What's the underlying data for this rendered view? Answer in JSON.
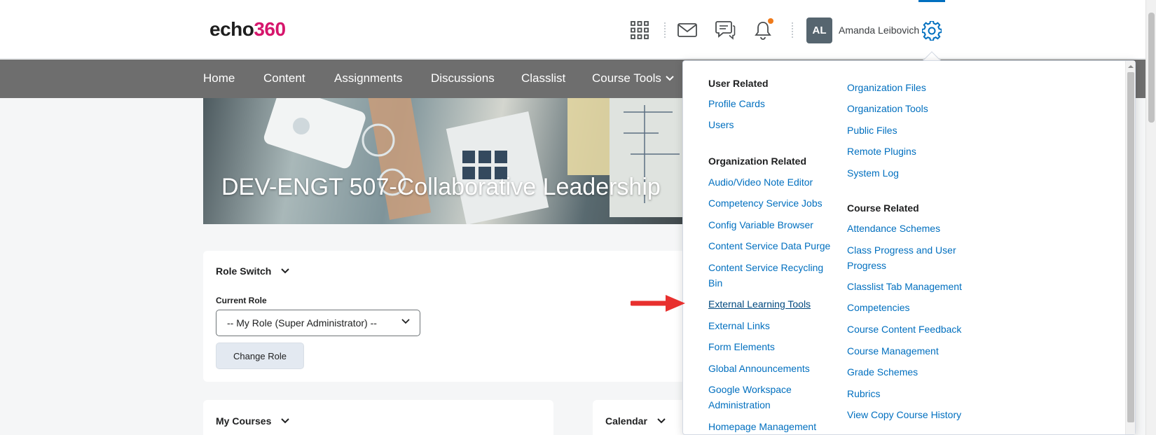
{
  "header": {
    "logo_text": "echo",
    "logo_num": "360",
    "user_initials": "AL",
    "user_name": "Amanda Leibovich"
  },
  "nav": {
    "items": [
      "Home",
      "Content",
      "Assignments",
      "Discussions",
      "Classlist",
      "Course Tools"
    ]
  },
  "banner": {
    "title": "DEV-ENGT 507-Collaborative Leadership"
  },
  "role_switch": {
    "title": "Role Switch",
    "current_role_label": "Current Role",
    "current_role_value": "-- My Role (Super Administrator) --",
    "button": "Change Role"
  },
  "widgets": {
    "my_courses": "My Courses",
    "calendar": "Calendar"
  },
  "admin_menu": {
    "user_related": {
      "heading": "User Related",
      "links": [
        "Profile Cards",
        "Users"
      ]
    },
    "organization_related": {
      "heading": "Organization Related",
      "links": [
        "Audio/Video Note Editor",
        "Competency Service Jobs",
        "Config Variable Browser",
        "Content Service Data Purge",
        "Content Service Recycling Bin",
        "External Learning Tools",
        "External Links",
        "Form Elements",
        "Global Announcements",
        "Google Workspace Administration",
        "Homepage Management"
      ]
    },
    "org_extra": {
      "links": [
        "Organization Files",
        "Organization Tools",
        "Public Files",
        "Remote Plugins",
        "System Log"
      ]
    },
    "course_related": {
      "heading": "Course Related",
      "links": [
        "Attendance Schemes",
        "Class Progress and User Progress",
        "Classlist Tab Management",
        "Competencies",
        "Course Content Feedback",
        "Course Management",
        "Grade Schemes",
        "Rubrics",
        "View Copy Course History"
      ]
    }
  },
  "colors": {
    "accent": "#006fbf",
    "nav": "#6e6e6e",
    "arrow": "#e8302e",
    "logo_num": "#d6166c"
  }
}
